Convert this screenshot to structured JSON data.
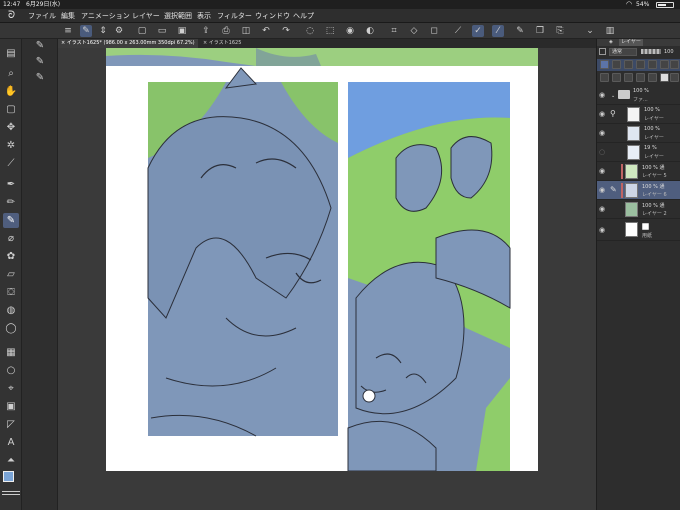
{
  "status_bar": {
    "time": "12:47",
    "date": "6月29日(水)",
    "battery": "54%"
  },
  "menu": {
    "items": [
      "ファイル",
      "編集",
      "アニメーション",
      "レイヤー",
      "選択範囲",
      "表示",
      "フィルター",
      "ウィンドウ",
      "ヘルプ"
    ]
  },
  "tabs": {
    "active": "イラスト1625* (986.00 x 263.00mm 350dpi 67.2%)",
    "inactive": "イラスト1625"
  },
  "layer_panel": {
    "title": "レイヤー",
    "blend_mode": "通常",
    "opacity": "100",
    "layers": [
      {
        "pct": "100 %",
        "name": "ファ..."
      },
      {
        "pct": "100 %",
        "name": "レイヤー"
      },
      {
        "pct": "100 %",
        "name": "レイヤー"
      },
      {
        "pct": "19 %",
        "name": "レイヤー"
      },
      {
        "pct": "100 % 通",
        "name": "レイヤー 5"
      },
      {
        "pct": "100 % 通",
        "name": "レイヤー 6"
      },
      {
        "pct": "100 % 通",
        "name": "レイヤー 2"
      },
      {
        "pct": "",
        "name": "用紙"
      }
    ]
  },
  "colors": {
    "accent": "#4f5e7e",
    "panel_blue": "#7f97b9",
    "grass": "#8fcd6a",
    "sky": "#6f9ee0"
  }
}
